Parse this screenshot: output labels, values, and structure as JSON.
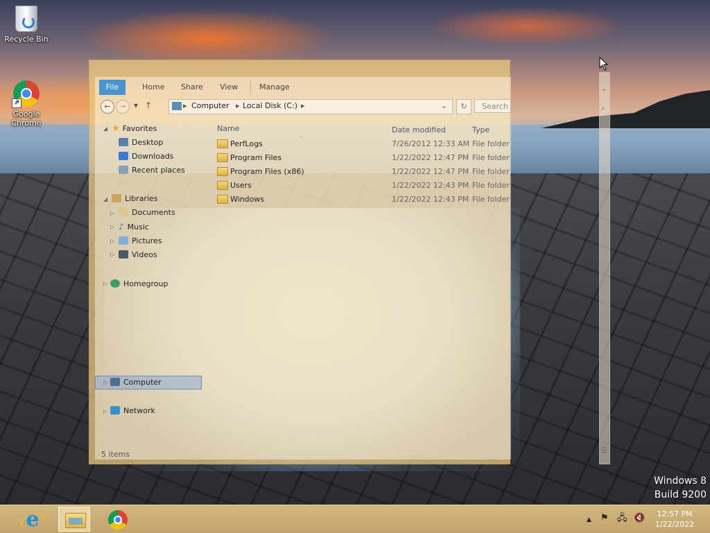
{
  "desktop": {
    "icons": [
      {
        "label": "Recycle Bin"
      },
      {
        "label": "Google\nChrome",
        "line1": "Google",
        "line2": "Chrome"
      }
    ],
    "watermark": {
      "line1": "Windows 8",
      "line2": "Build 9200"
    }
  },
  "explorer": {
    "ribbon_tabs": [
      "File",
      "Home",
      "Share",
      "View",
      "Manage"
    ],
    "breadcrumb": [
      "Computer",
      "Local Disk (C:)"
    ],
    "search_placeholder": "Search",
    "nav": {
      "favorites": "Favorites",
      "favorites_items": [
        "Desktop",
        "Downloads",
        "Recent places"
      ],
      "libraries": "Libraries",
      "libraries_items": [
        "Documents",
        "Music",
        "Pictures",
        "Videos"
      ],
      "homegroup": "Homegroup",
      "computer": "Computer",
      "network": "Network"
    },
    "columns": {
      "name": "Name",
      "date": "Date modified",
      "type": "Type"
    },
    "rows": [
      {
        "name": "PerfLogs",
        "date": "7/26/2012 12:33 AM",
        "type": "File folder"
      },
      {
        "name": "Program Files",
        "date": "1/22/2022 12:47 PM",
        "type": "File folder"
      },
      {
        "name": "Program Files (x86)",
        "date": "1/22/2022 12:47 PM",
        "type": "File folder"
      },
      {
        "name": "Users",
        "date": "1/22/2022 12:43 PM",
        "type": "File folder"
      },
      {
        "name": "Windows",
        "date": "1/22/2022 12:43 PM",
        "type": "File folder"
      }
    ],
    "status": "5 items",
    "accent_color": "#2a8ad6"
  },
  "taskbar": {
    "pinned": [
      "ie-icon",
      "file-explorer-icon",
      "chrome-icon"
    ],
    "clock": {
      "time": "12:57 PM",
      "date": "1/22/2022"
    },
    "tray": [
      "show-hidden-icons-icon",
      "action-center-flag-icon",
      "network-icon",
      "volume-muted-icon"
    ]
  }
}
